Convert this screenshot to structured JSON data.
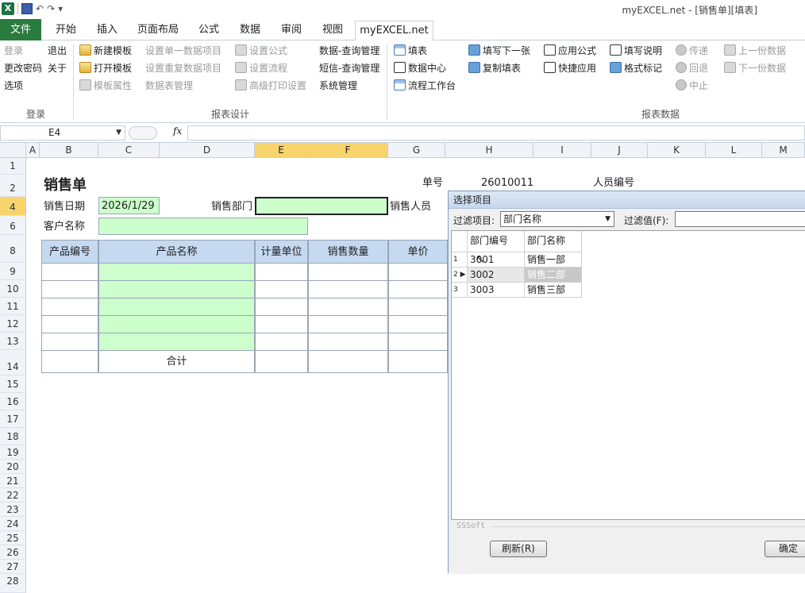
{
  "window": {
    "title": "myEXCEL.net - [销售单][填表]"
  },
  "qat": {
    "logo": "X",
    "undo": "↶",
    "redo": "↷"
  },
  "tabs": [
    "文件",
    "开始",
    "插入",
    "页面布局",
    "公式",
    "数据",
    "审阅",
    "视图",
    "myEXCEL.net"
  ],
  "ribbon": {
    "login": "登录",
    "exit": "退出",
    "change_pwd": "更改密码",
    "about": "关于",
    "options": "选项",
    "new_template": "新建模板",
    "open_template": "打开模板",
    "template_props": "模板属性",
    "set_single": "设置单一数据项目",
    "set_repeat": "设置重复数据项目",
    "table_mgmt": "数据表管理",
    "set_formula": "设置公式",
    "set_flow": "设置流程",
    "adv_print": "高级打印设置",
    "data_query": "数据-查询管理",
    "sms_query": "短信-查询管理",
    "sys_mgmt": "系统管理",
    "fill": "填表",
    "data_center": "数据中心",
    "flow_desk": "流程工作台",
    "fill_next": "填写下一张",
    "copy_fill": "复制填表",
    "apply_formula": "应用公式",
    "quick_apply": "快捷应用",
    "fill_desc": "填写说明",
    "format_mark": "格式标记",
    "send": "传递",
    "back": "回退",
    "stop": "中止",
    "prev_data": "上一份数据",
    "next_data": "下一份数据",
    "group_login": "登录",
    "group_design": "报表设计",
    "group_data": "报表数据"
  },
  "formula_bar": {
    "cell_ref": "E4",
    "fx": "fx",
    "value": ""
  },
  "columns": [
    "A",
    "B",
    "C",
    "D",
    "E",
    "F",
    "G",
    "H",
    "I",
    "J",
    "K",
    "L",
    "M"
  ],
  "rows": [
    "1",
    "2",
    "4",
    "6",
    "8",
    "9",
    "10",
    "11",
    "12",
    "13",
    "14",
    "15",
    "16",
    "17",
    "18",
    "19",
    "20",
    "21",
    "22",
    "23",
    "24",
    "25",
    "26",
    "27",
    "28"
  ],
  "form": {
    "title": "销售单",
    "order_no_label": "单号",
    "order_no": "26010011",
    "staff_no_label": "人员编号",
    "date_label": "销售日期",
    "date_value": "2026/1/29",
    "dept_label": "销售部门",
    "salesperson_label": "销售人员",
    "customer_label": "客户名称",
    "headers": [
      "产品编号",
      "产品名称",
      "计量单位",
      "销售数量",
      "单价"
    ],
    "total_label": "合计"
  },
  "dialog": {
    "title": "选择项目",
    "filter_item_label": "过滤项目:",
    "filter_item_value": "部门名称",
    "filter_value_label": "过滤值(F):",
    "columns": [
      "部门编号",
      "部门名称"
    ],
    "rows": [
      {
        "n": "1",
        "code": "3001",
        "name": "销售一部"
      },
      {
        "n": "2",
        "code": "3002",
        "name": "销售二部"
      },
      {
        "n": "3",
        "code": "3003",
        "name": "销售三部"
      }
    ],
    "watermark": "SSSoft",
    "refresh_button": "刷新(R)",
    "ok_button": "确定"
  }
}
